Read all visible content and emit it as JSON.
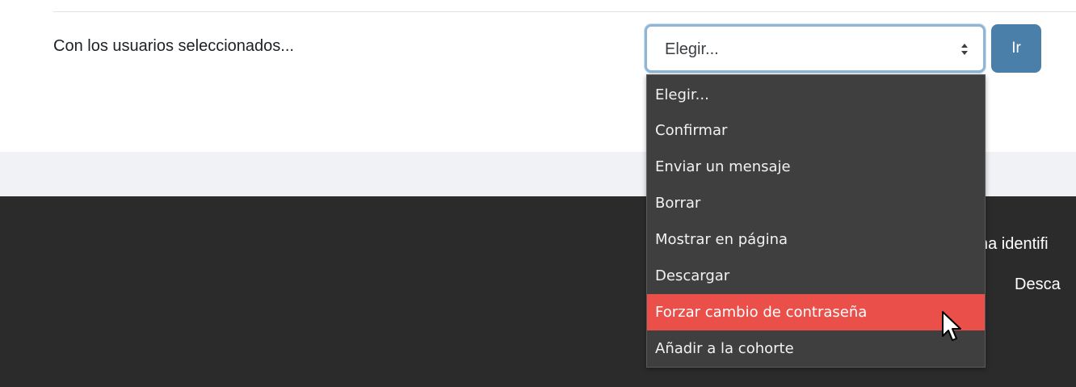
{
  "bulk_actions": {
    "label": "Con los usuarios seleccionados...",
    "select": {
      "selected_value": "Elegir...",
      "options": [
        "Elegir...",
        "Confirmar",
        "Enviar un mensaje",
        "Borrar",
        "Mostrar en página",
        "Descargar",
        "Forzar cambio de contraseña",
        "Añadir a la cohorte"
      ],
      "highlighted_option": "Forzar cambio de contraseña"
    },
    "go_button_label": "Ir"
  },
  "footer": {
    "line1": "na identifi",
    "line2": "Desca"
  },
  "colors": {
    "accent": "#4a7fa9",
    "highlight": "#ea4f4a",
    "dropdown_bg": "#3f3f3f",
    "footer_bg": "#2b2b2b"
  },
  "icons": {
    "select_arrows": "select-arrows-icon",
    "cursor": "mouse-pointer-icon"
  }
}
